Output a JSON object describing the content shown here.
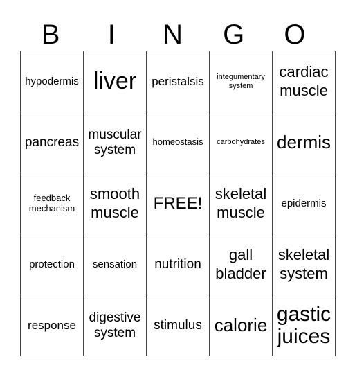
{
  "header": [
    "B",
    "I",
    "N",
    "G",
    "O"
  ],
  "cells": [
    [
      "hypodermis",
      "liver",
      "peristalsis",
      "integumentary system",
      "cardiac muscle"
    ],
    [
      "pancreas",
      "muscular system",
      "homeostasis",
      "carbohydrates",
      "dermis"
    ],
    [
      "feedback mechanism",
      "smooth muscle",
      "FREE!",
      "skeletal muscle",
      "epidermis"
    ],
    [
      "protection",
      "sensation",
      "nutrition",
      "gall bladder",
      "skeletal system"
    ],
    [
      "response",
      "digestive system",
      "stimulus",
      "calorie",
      "gastic juices"
    ]
  ]
}
